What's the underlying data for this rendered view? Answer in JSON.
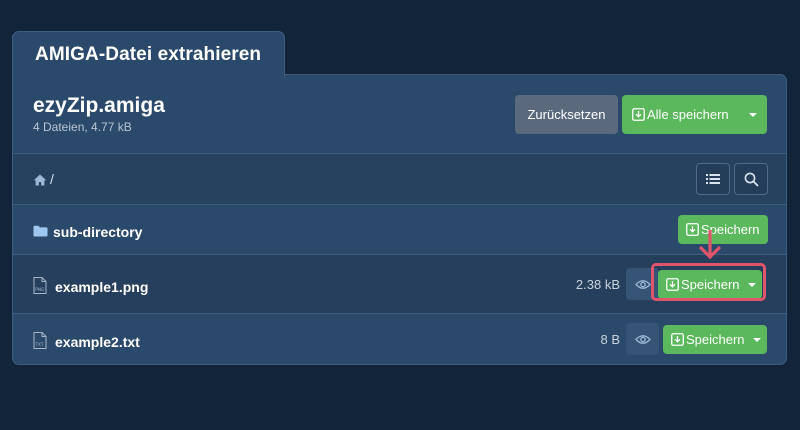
{
  "tab": {
    "title": "AMIGA-Datei extrahieren"
  },
  "archive": {
    "name": "ezyZip.amiga",
    "summary": "4 Dateien, 4.77 kB"
  },
  "toolbar": {
    "reset_label": "Zurücksetzen",
    "save_all_label": "Alle speichern"
  },
  "path": {
    "current": "/"
  },
  "entries": [
    {
      "type": "directory",
      "name": "sub-directory",
      "save_label": "Speichern",
      "icon": "folder-icon"
    },
    {
      "type": "file",
      "name": "example1.png",
      "size": "2.38 kB",
      "save_label": "Speichern",
      "icon": "png-file-icon",
      "icon_text": "PNG"
    },
    {
      "type": "file",
      "name": "example2.txt",
      "size": "8 B",
      "save_label": "Speichern",
      "icon": "txt-file-icon",
      "icon_text": "TXT"
    }
  ],
  "colors": {
    "background": "#12243a",
    "panel": "#2b4a6b",
    "success": "#5cb85c",
    "highlight": "#e0556a",
    "reset_button": "#5a6a7c"
  }
}
